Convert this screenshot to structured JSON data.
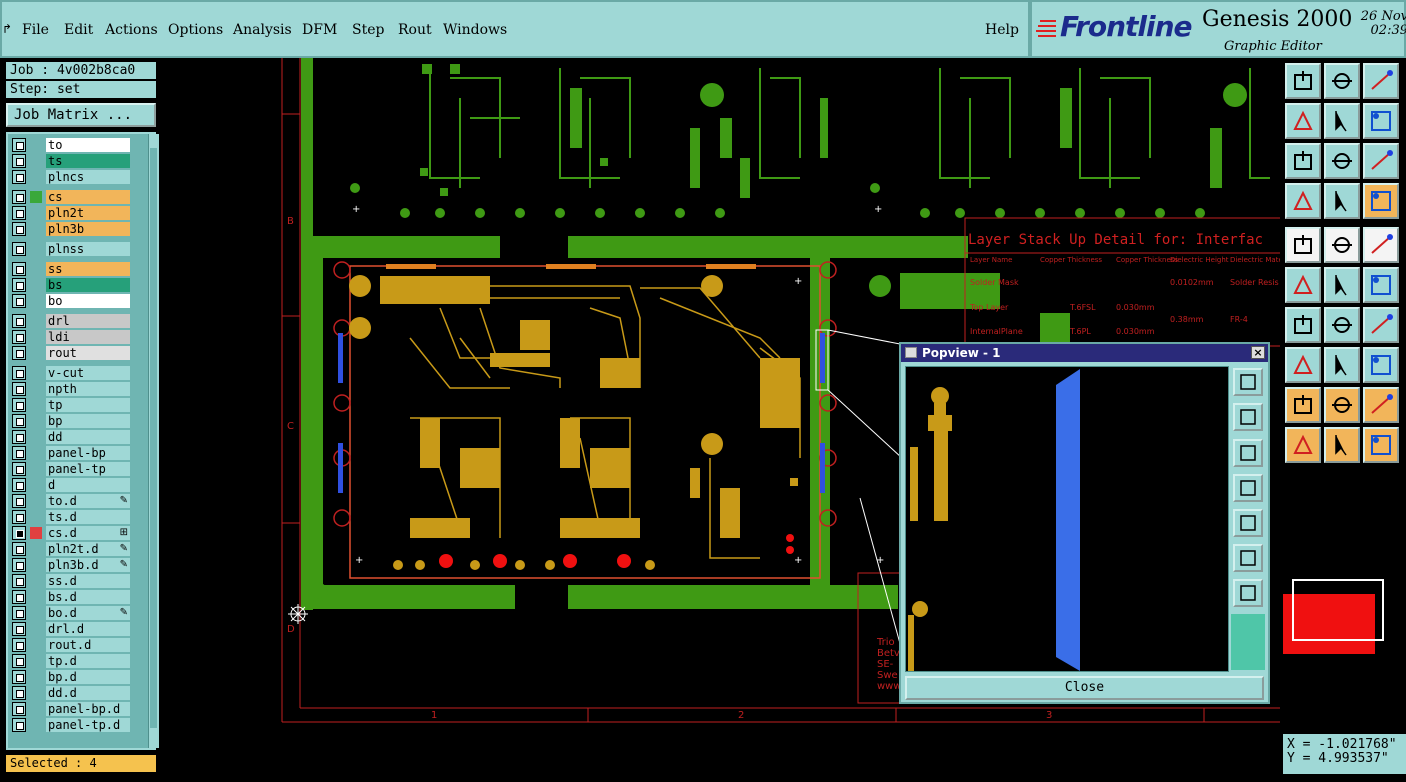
{
  "menubar": {
    "items": [
      "File",
      "Edit",
      "Actions",
      "Options",
      "Analysis",
      "DFM",
      "Step",
      "Rout",
      "Windows"
    ],
    "help": "Help"
  },
  "logo": {
    "brand": "Frontline",
    "product": "Genesis 2000",
    "subtitle": "Graphic Editor",
    "date": "26 Nov",
    "time": "02:39"
  },
  "left_panel": {
    "job": "Job : 4v002b8ca0",
    "step": "Step: set",
    "matrix_button": "Job Matrix ...",
    "selected": "Selected : 4",
    "layers": [
      {
        "name": "to",
        "color": "#ffffff",
        "tag": ""
      },
      {
        "name": "ts",
        "color": "#26a07a",
        "tag": ""
      },
      {
        "name": "plncs",
        "color": "#9fd8d6",
        "tag": ""
      },
      {
        "name": "cs",
        "color": "#f2b55a",
        "tag": "#3aa83a"
      },
      {
        "name": "pln2t",
        "color": "#f2b55a",
        "tag": ""
      },
      {
        "name": "pln3b",
        "color": "#f2b55a",
        "tag": ""
      },
      {
        "name": "plnss",
        "color": "#9fd8d6",
        "tag": ""
      },
      {
        "name": "ss",
        "color": "#f2b55a",
        "tag": ""
      },
      {
        "name": "bs",
        "color": "#26a07a",
        "tag": ""
      },
      {
        "name": "bo",
        "color": "#ffffff",
        "tag": ""
      },
      {
        "name": "drl",
        "color": "#c8c8c8",
        "tag": ""
      },
      {
        "name": "ldi",
        "color": "#c8c8c8",
        "tag": ""
      },
      {
        "name": "rout",
        "color": "#e0e0e0",
        "tag": ""
      },
      {
        "name": "v-cut",
        "color": "#9fd8d6",
        "tag": ""
      },
      {
        "name": "npth",
        "color": "#9fd8d6",
        "tag": ""
      },
      {
        "name": "tp",
        "color": "#9fd8d6",
        "tag": ""
      },
      {
        "name": "bp",
        "color": "#9fd8d6",
        "tag": ""
      },
      {
        "name": "dd",
        "color": "#9fd8d6",
        "tag": ""
      },
      {
        "name": "panel-bp",
        "color": "#9fd8d6",
        "tag": ""
      },
      {
        "name": "panel-tp",
        "color": "#9fd8d6",
        "tag": ""
      },
      {
        "name": "d",
        "color": "#9fd8d6",
        "tag": ""
      },
      {
        "name": "to.d",
        "color": "#9fd8d6",
        "tag": "",
        "mark": "✎"
      },
      {
        "name": "ts.d",
        "color": "#9fd8d6",
        "tag": ""
      },
      {
        "name": "cs.d",
        "color": "#9fd8d6",
        "tag": "#e04040",
        "on": true,
        "mark": "⊞"
      },
      {
        "name": "pln2t.d",
        "color": "#9fd8d6",
        "tag": "",
        "mark": "✎"
      },
      {
        "name": "pln3b.d",
        "color": "#9fd8d6",
        "tag": "",
        "mark": "✎"
      },
      {
        "name": "ss.d",
        "color": "#9fd8d6",
        "tag": ""
      },
      {
        "name": "bs.d",
        "color": "#9fd8d6",
        "tag": ""
      },
      {
        "name": "bo.d",
        "color": "#9fd8d6",
        "tag": "",
        "mark": "✎"
      },
      {
        "name": "drl.d",
        "color": "#9fd8d6",
        "tag": ""
      },
      {
        "name": "rout.d",
        "color": "#9fd8d6",
        "tag": ""
      },
      {
        "name": "tp.d",
        "color": "#9fd8d6",
        "tag": ""
      },
      {
        "name": "bp.d",
        "color": "#9fd8d6",
        "tag": ""
      },
      {
        "name": "dd.d",
        "color": "#9fd8d6",
        "tag": ""
      },
      {
        "name": "panel-bp.d",
        "color": "#9fd8d6",
        "tag": ""
      },
      {
        "name": "panel-tp.d",
        "color": "#9fd8d6",
        "tag": ""
      }
    ]
  },
  "canvas": {
    "row_labels": [
      "B",
      "C",
      "D"
    ],
    "col_labels": [
      "1",
      "2",
      "3"
    ],
    "stackup_title": "Layer Stack Up Detail for: Interfac",
    "stackup_cols": [
      "Layer\nName",
      "Copper\nThickness",
      "Copper\nThickness",
      "Dielectric\nHeight",
      "Dielectric\nMaterial"
    ],
    "stackup_rows": [
      [
        "Solder Mask",
        "",
        "",
        "0.0102mm",
        "Solder Resis"
      ],
      [
        "Top Layer",
        "T.6FSL",
        "0.030mm",
        "",
        ""
      ],
      [
        "InternalPlane",
        "T.6PL",
        "0.030mm",
        "0.38mm",
        "FR-4"
      ]
    ],
    "company_lines": [
      "Trio",
      "Betv",
      "SE-",
      "Swe",
      "www"
    ]
  },
  "popview": {
    "title": "Popview - 1",
    "close": "Close",
    "buttons": [
      "fit-icon",
      "arrow-up-icon",
      "arrow-down-icon",
      "arrow-left-icon",
      "arrow-right-icon",
      "zoom-in-icon",
      "zoom-out-icon"
    ]
  },
  "toolbar": {
    "buttons": [
      "arrow-up-box-icon",
      "arrow-down-box-icon",
      "home-icon",
      "arrow-left-box-icon",
      "arrow-right-box-icon",
      "undo-redo-icon",
      "fit-screen-icon",
      "zoom-center-icon",
      "ratio-icon",
      "tools-icon",
      "probe-icon",
      "layers-icon",
      "rotate-icon",
      "measure-icon",
      "ruler-icon",
      "connect-icon",
      "delete-node-icon",
      "move-node-icon",
      "line-icon",
      "edit-line-icon",
      "undo-icon",
      "snap-icon",
      "line-dash-icon",
      "zoom-box-icon",
      "triangle-icon",
      "text-icon",
      "letter-icon",
      "select-icon",
      "select-box-icon",
      "select-area-icon"
    ],
    "coords": {
      "x": "X = -1.021768\"",
      "y": "Y = 4.993537\""
    }
  }
}
